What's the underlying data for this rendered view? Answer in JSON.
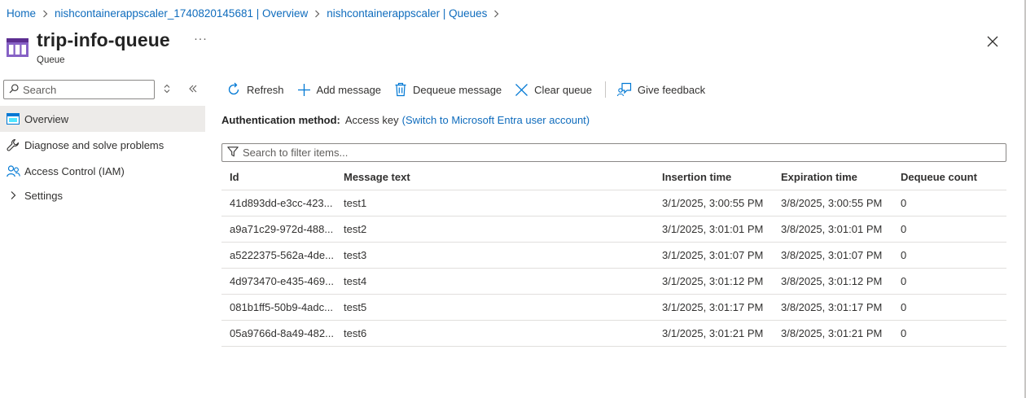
{
  "breadcrumb": [
    {
      "label": "Home"
    },
    {
      "label": "nishcontainerappscaler_1740820145681 | Overview"
    },
    {
      "label": "nishcontainerappscaler | Queues"
    }
  ],
  "header": {
    "title": "trip-info-queue",
    "subtitle": "Queue",
    "more": "···"
  },
  "sidebar": {
    "search_placeholder": "Search",
    "items": [
      {
        "label": "Overview",
        "icon": "overview-icon",
        "active": true
      },
      {
        "label": "Diagnose and solve problems",
        "icon": "wrench-icon"
      },
      {
        "label": "Access Control (IAM)",
        "icon": "people-icon"
      },
      {
        "label": "Settings",
        "icon": "chevron-right-icon"
      }
    ]
  },
  "toolbar": {
    "refresh": "Refresh",
    "add_message": "Add message",
    "dequeue_message": "Dequeue message",
    "clear_queue": "Clear queue",
    "give_feedback": "Give feedback"
  },
  "auth": {
    "label": "Authentication method:",
    "value": "Access key",
    "link": "(Switch to Microsoft Entra user account)"
  },
  "filter": {
    "placeholder": "Search to filter items..."
  },
  "table": {
    "columns": [
      "Id",
      "Message text",
      "Insertion time",
      "Expiration time",
      "Dequeue count"
    ],
    "rows": [
      [
        "41d893dd-e3cc-423...",
        "test1",
        "3/1/2025, 3:00:55 PM",
        "3/8/2025, 3:00:55 PM",
        "0"
      ],
      [
        "a9a71c29-972d-488...",
        "test2",
        "3/1/2025, 3:01:01 PM",
        "3/8/2025, 3:01:01 PM",
        "0"
      ],
      [
        "a5222375-562a-4de...",
        "test3",
        "3/1/2025, 3:01:07 PM",
        "3/8/2025, 3:01:07 PM",
        "0"
      ],
      [
        "4d973470-e435-469...",
        "test4",
        "3/1/2025, 3:01:12 PM",
        "3/8/2025, 3:01:12 PM",
        "0"
      ],
      [
        "081b1ff5-50b9-4adc...",
        "test5",
        "3/1/2025, 3:01:17 PM",
        "3/8/2025, 3:01:17 PM",
        "0"
      ],
      [
        "05a9766d-8a49-482...",
        "test6",
        "3/1/2025, 3:01:21 PM",
        "3/8/2025, 3:01:21 PM",
        "0"
      ]
    ]
  },
  "colors": {
    "link": "#0f6cbd",
    "queue_icon": "#8661c5",
    "active_bg": "#edebe9"
  }
}
